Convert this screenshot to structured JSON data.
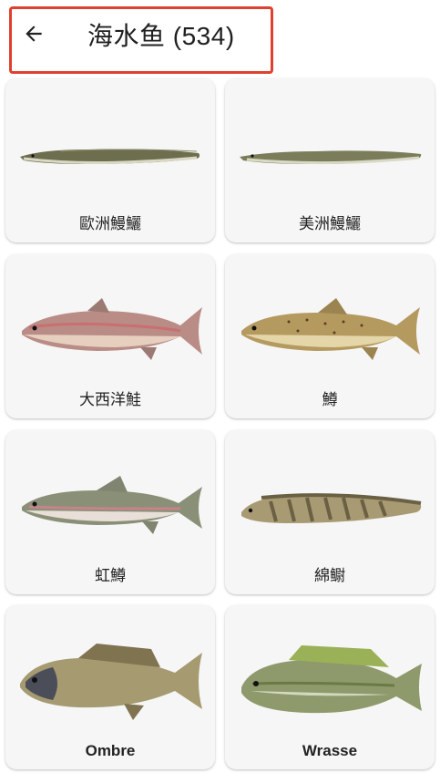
{
  "header": {
    "title": "海水鱼 (534)",
    "back_icon": "arrow-left-icon"
  },
  "fish": [
    {
      "label": "歐洲鰻鱺"
    },
    {
      "label": "美洲鰻鱺"
    },
    {
      "label": "大西洋鮭"
    },
    {
      "label": "鱒"
    },
    {
      "label": "虹鱒"
    },
    {
      "label": "綿鳚"
    },
    {
      "label": "Ombre"
    },
    {
      "label": "Wrasse"
    }
  ],
  "colors": {
    "highlight_border": "#e0402f",
    "card_background": "#f6f6f6"
  }
}
